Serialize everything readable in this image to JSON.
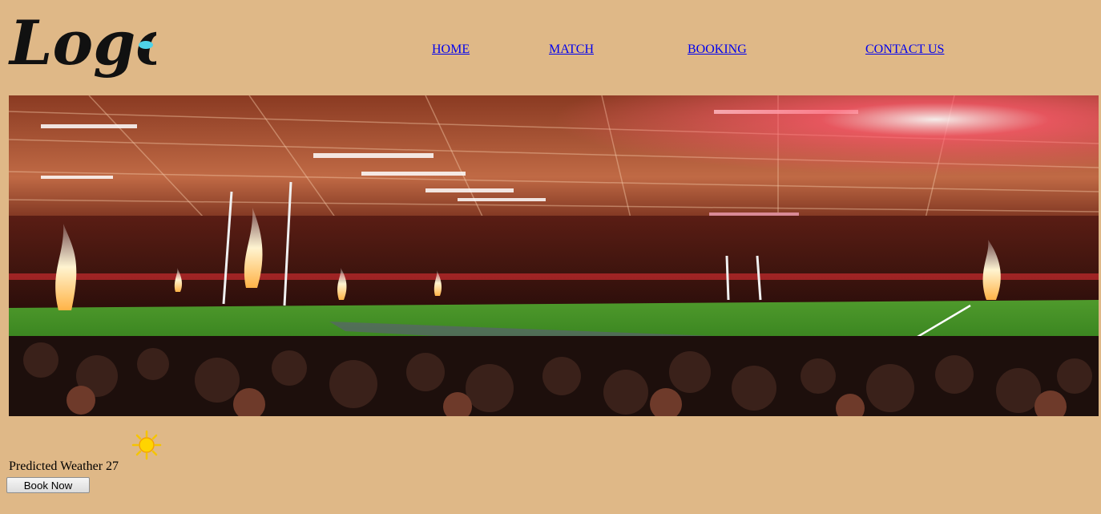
{
  "logo": {
    "text": "Logo",
    "accent_color": "#4fd3e8"
  },
  "nav": {
    "items": [
      {
        "label": "HOME"
      },
      {
        "label": "MATCH"
      },
      {
        "label": "BOOKING"
      },
      {
        "label": "CONTACT US"
      }
    ]
  },
  "hero": {
    "icon": "stadium-photo"
  },
  "weather": {
    "label": "Predicted Weather 27",
    "icon": "sun-icon",
    "icon_color": "#f5c400"
  },
  "booking": {
    "button_label": "Book Now"
  },
  "colors": {
    "page_background": "#dfb887",
    "link": "#0000ee"
  }
}
